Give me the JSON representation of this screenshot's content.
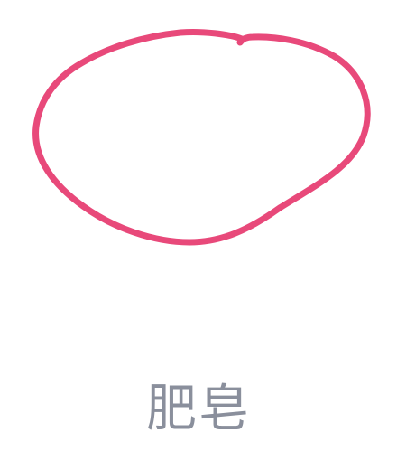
{
  "drawing": {
    "shape": "oval",
    "stroke_color": "#e8497a"
  },
  "caption": {
    "text": "肥皂",
    "color": "#8a8f9c"
  }
}
